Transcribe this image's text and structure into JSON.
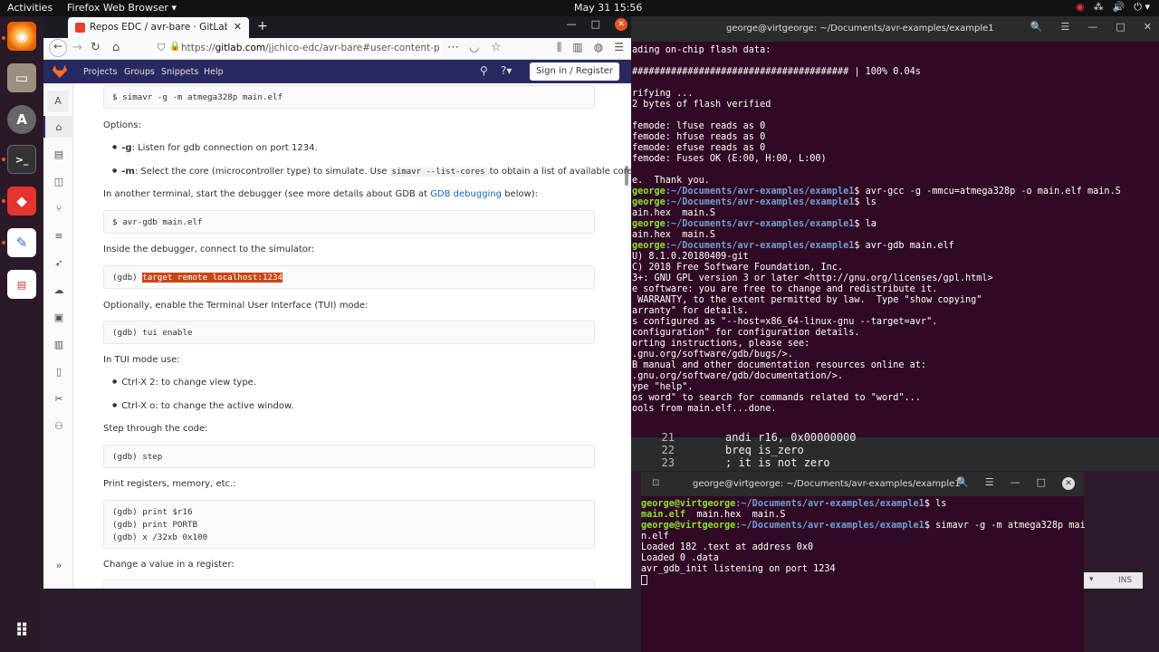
{
  "topbar": {
    "activities": "Activities",
    "app": "Firefox Web Browser ▾",
    "clock": "May 31  15:56",
    "tray": [
      "◉",
      "⁂",
      "🔊",
      "⏻ ▾"
    ]
  },
  "dock": {
    "items": [
      "firefox",
      "files",
      "software",
      "terminal",
      "anydesk",
      "editor",
      "scanner",
      "apps"
    ]
  },
  "browser": {
    "tab_title": "Repos EDC / avr-bare · GitLab",
    "tab_close": "✕",
    "new_tab": "+",
    "window_controls": {
      "min": "—",
      "max": "□",
      "close": "✕"
    },
    "url_host": "gitlab.com",
    "url_prefix": "https://",
    "url_rest": "/jjchico-edc/avr-bare#user-content-proje",
    "gitlab_nav": [
      "Projects",
      "Groups",
      "Snippets",
      "Help"
    ],
    "sign_in": "Sign in / Register",
    "sidebar_project_letter": "A"
  },
  "content": {
    "cmd_simavr": "$ simavr -g -m atmega328p main.elf",
    "options_label": "Options:",
    "opt_g_key": "-g",
    "opt_g_text": ": Listen for gdb connection on port 1234.",
    "opt_m_key": "-m",
    "opt_m_text_a": ": Select the core (microcontroller type) to simulate. Use ",
    "opt_m_code": "simavr --list-cores",
    "opt_m_text_b": " to obtain a list of available cores.",
    "debugger_text_a": "In another terminal, start the debugger (see more details about GDB at ",
    "debugger_link": "GDB debugging",
    "debugger_text_b": " below):",
    "cmd_avrgdb": "$ avr-gdb main.elf",
    "connect_text": "Inside the debugger, connect to the simulator:",
    "gdb_prompt": "(gdb) ",
    "cmd_target": "target remote localhost:1234",
    "tui_text": "Optionally, enable the Terminal User Interface (TUI) mode:",
    "cmd_tui": "(gdb) tui enable",
    "tui_mode_label": "In TUI mode use:",
    "tui_bullet_1": "Ctrl-X 2: to change view type.",
    "tui_bullet_2": "Ctrl-X o: to change the active window.",
    "step_text": "Step through the code:",
    "cmd_step": "(gdb) step",
    "print_text": "Print registers, memory, etc.:",
    "cmd_print": "(gdb) print $r16\n(gdb) print PORTB\n(gdb) x /32xb 0x100",
    "change_text": "Change a value in a register:"
  },
  "term_bg": {
    "title": "george@virtgeorge: ~/Documents/avr-examples/example1",
    "controls": [
      "🔍",
      "☰",
      "—",
      "□",
      "✕"
    ],
    "lines_a": "ading on-chip flash data:\n\n####################################### | 100% 0.04s\n\nrifying ...\n2 bytes of flash verified\n\nfemode: lfuse reads as 0\nfemode: hfuse reads as 0\nfemode: efuse reads as 0\nfemode: Fuses OK (E:00, H:00, L:00)\n\ne.  Thank you.\n",
    "p1_user": "george",
    "p1_path": ":~/Documents/avr-examples/example1",
    "p1_cmd": "$ avr-gcc -g -mmcu=atmega328p -o main.elf main.S",
    "p2_user": "george",
    "p2_path": ":~/Documents/avr-examples/example1",
    "p2_cmd": "$ ls",
    "ls1": "ain.hex  main.S",
    "p3_user": "george",
    "p3_path": ":~/Documents/avr-examples/example1",
    "p3_cmd": "$ la",
    "ls2": "ain.hex  main.S",
    "p4_user": "george",
    "p4_path": ":~/Documents/avr-examples/example1",
    "p4_cmd": "$ avr-gdb main.elf",
    "lines_b": "U) 8.1.0.20180409-git\nC) 2018 Free Software Foundation, Inc.\n3+: GNU GPL version 3 or later <http://gnu.org/licenses/gpl.html>\ne software: you are free to change and redistribute it.\n WARRANTY, to the extent permitted by law.  Type \"show copying\"\narranty\" for details.\ns configured as \"--host=x86_64-linux-gnu --target=avr\".\nconfiguration\" for configuration details.\norting instructions, please see:\n.gnu.org/software/gdb/bugs/>.\nB manual and other documentation resources online at:\n.gnu.org/software/gdb/documentation/>.\nype \"help\".\nos word\" to search for commands related to \"word\"...\nools from main.elf...done."
  },
  "editor": {
    "lines": [
      {
        "num": "21",
        "code": "andi r16, 0x00000000"
      },
      {
        "num": "22",
        "code": "breq is_zero"
      },
      {
        "num": "23",
        "code": "; it is not zero"
      }
    ]
  },
  "term_fg": {
    "title": "george@virtgeorge: ~/Documents/avr-examples/example1",
    "controls": [
      "🔍",
      "☰",
      "—",
      "□",
      "✕"
    ],
    "p1_user": "george@virtgeorge",
    "p1_path": ":~/Documents/avr-examples/example1",
    "p1_cmd": "$ ls",
    "ls_out_a": "main.elf",
    "ls_out_b": "  main.hex  main.S",
    "p2_user": "george@virtgeorge",
    "p2_path": ":~/Documents/avr-examples/example1",
    "p2_cmd": "$ simavr -g -m atmega328p mai",
    "cont": "n.elf",
    "out1": "Loaded 182 .text at address 0x0",
    "out2": "Loaded 0 .data",
    "out3": "avr_gdb_init listening on port 1234",
    "ins": "INS"
  }
}
